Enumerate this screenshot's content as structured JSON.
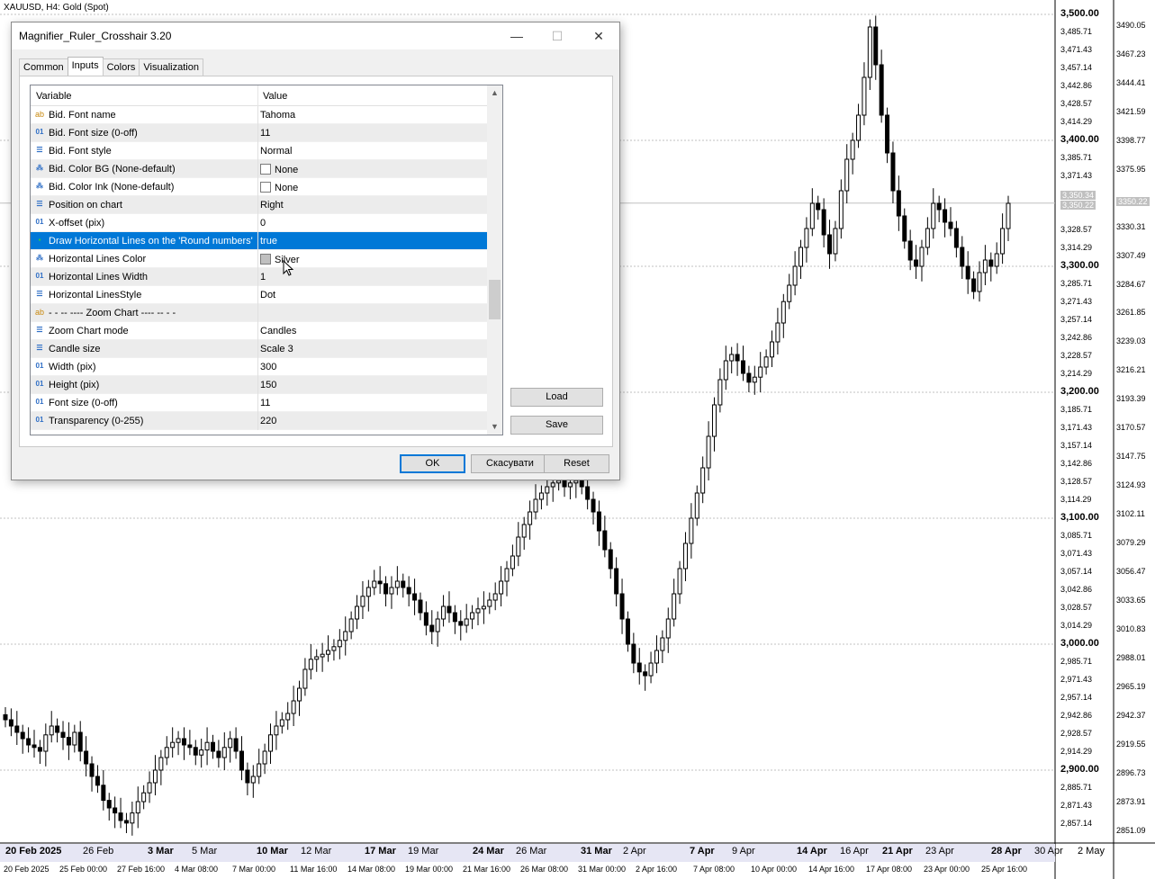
{
  "chart": {
    "symbol_label": "XAUUSD, H4:  Gold (Spot)",
    "grid_color": "#c0c0c0",
    "candle_color": "#000000",
    "price_scale": [
      {
        "text": "3,500.00",
        "price": 3500.0,
        "round": true
      },
      {
        "text": "3,485.71",
        "price": 3485.71
      },
      {
        "text": "3,471.43",
        "price": 3471.43
      },
      {
        "text": "3,457.14",
        "price": 3457.14
      },
      {
        "text": "3,442.86",
        "price": 3442.86
      },
      {
        "text": "3,428.57",
        "price": 3428.57
      },
      {
        "text": "3,414.29",
        "price": 3414.29
      },
      {
        "text": "3,400.00",
        "price": 3400.0,
        "round": true
      },
      {
        "text": "3,385.71",
        "price": 3385.71
      },
      {
        "text": "3,371.43",
        "price": 3371.43
      },
      {
        "text": "3,328.57",
        "price": 3328.57
      },
      {
        "text": "3,314.29",
        "price": 3314.29
      },
      {
        "text": "3,300.00",
        "price": 3300.0,
        "round": true
      },
      {
        "text": "3,285.71",
        "price": 3285.71
      },
      {
        "text": "3,271.43",
        "price": 3271.43
      },
      {
        "text": "3,257.14",
        "price": 3257.14
      },
      {
        "text": "3,242.86",
        "price": 3242.86
      },
      {
        "text": "3,228.57",
        "price": 3228.57
      },
      {
        "text": "3,214.29",
        "price": 3214.29
      },
      {
        "text": "3,200.00",
        "price": 3200.0,
        "round": true
      },
      {
        "text": "3,185.71",
        "price": 3185.71
      },
      {
        "text": "3,171.43",
        "price": 3171.43
      },
      {
        "text": "3,157.14",
        "price": 3157.14
      },
      {
        "text": "3,142.86",
        "price": 3142.86
      },
      {
        "text": "3,128.57",
        "price": 3128.57
      },
      {
        "text": "3,114.29",
        "price": 3114.29
      },
      {
        "text": "3,100.00",
        "price": 3100.0,
        "round": true
      },
      {
        "text": "3,085.71",
        "price": 3085.71
      },
      {
        "text": "3,071.43",
        "price": 3071.43
      },
      {
        "text": "3,057.14",
        "price": 3057.14
      },
      {
        "text": "3,042.86",
        "price": 3042.86
      },
      {
        "text": "3,028.57",
        "price": 3028.57
      },
      {
        "text": "3,014.29",
        "price": 3014.29
      },
      {
        "text": "3,000.00",
        "price": 3000.0,
        "round": true
      },
      {
        "text": "2,985.71",
        "price": 2985.71
      },
      {
        "text": "2,971.43",
        "price": 2971.43
      },
      {
        "text": "2,957.14",
        "price": 2957.14
      },
      {
        "text": "2,942.86",
        "price": 2942.86
      },
      {
        "text": "2,928.57",
        "price": 2928.57
      },
      {
        "text": "2,914.29",
        "price": 2914.29
      },
      {
        "text": "2,900.00",
        "price": 2900.0,
        "round": true
      },
      {
        "text": "2,885.71",
        "price": 2885.71
      },
      {
        "text": "2,871.43",
        "price": 2871.43
      },
      {
        "text": "2,857.14",
        "price": 2857.14
      }
    ],
    "sub_scale": [
      {
        "text": "3490.05",
        "price": 3490.05
      },
      {
        "text": "3467.23",
        "price": 3467.23
      },
      {
        "text": "3444.41",
        "price": 3444.41
      },
      {
        "text": "3421.59",
        "price": 3421.59
      },
      {
        "text": "3398.77",
        "price": 3398.77
      },
      {
        "text": "3375.95",
        "price": 3375.95
      },
      {
        "text": "3330.31",
        "price": 3330.31
      },
      {
        "text": "3307.49",
        "price": 3307.49
      },
      {
        "text": "3284.67",
        "price": 3284.67
      },
      {
        "text": "3261.85",
        "price": 3261.85
      },
      {
        "text": "3239.03",
        "price": 3239.03
      },
      {
        "text": "3216.21",
        "price": 3216.21
      },
      {
        "text": "3193.39",
        "price": 3193.39
      },
      {
        "text": "3170.57",
        "price": 3170.57
      },
      {
        "text": "3147.75",
        "price": 3147.75
      },
      {
        "text": "3124.93",
        "price": 3124.93
      },
      {
        "text": "3102.11",
        "price": 3102.11
      },
      {
        "text": "3079.29",
        "price": 3079.29
      },
      {
        "text": "3056.47",
        "price": 3056.47
      },
      {
        "text": "3033.65",
        "price": 3033.65
      },
      {
        "text": "3010.83",
        "price": 3010.83
      },
      {
        "text": "2988.01",
        "price": 2988.01
      },
      {
        "text": "2965.19",
        "price": 2965.19
      },
      {
        "text": "2942.37",
        "price": 2942.37
      },
      {
        "text": "2919.55",
        "price": 2919.55
      },
      {
        "text": "2896.73",
        "price": 2896.73
      },
      {
        "text": "2873.91",
        "price": 2873.91
      },
      {
        "text": "2851.09",
        "price": 2851.09
      }
    ],
    "price_tags": {
      "ask": "3,350.34",
      "bid": "3,350.22",
      "sub": "3350.22"
    },
    "date_axis_top": [
      {
        "text": "20 Feb 2025",
        "bold": true
      },
      {
        "text": "26 Feb"
      },
      {
        "text": "3 Mar",
        "bold": true
      },
      {
        "text": "5 Mar"
      },
      {
        "text": "10 Mar",
        "bold": true
      },
      {
        "text": "12 Mar"
      },
      {
        "text": "17 Mar",
        "bold": true
      },
      {
        "text": "19 Mar"
      },
      {
        "text": "24 Mar",
        "bold": true
      },
      {
        "text": "26 Mar"
      },
      {
        "text": "31 Mar",
        "bold": true
      },
      {
        "text": "2 Apr"
      },
      {
        "text": "7 Apr",
        "bold": true
      },
      {
        "text": "9 Apr"
      },
      {
        "text": "14 Apr",
        "bold": true
      },
      {
        "text": "16 Apr"
      },
      {
        "text": "21 Apr",
        "bold": true
      },
      {
        "text": "23 Apr"
      },
      {
        "text": "28 Apr",
        "bold": true
      },
      {
        "text": "30 Apr"
      },
      {
        "text": "2 May"
      }
    ],
    "date_axis_bottom": [
      "20 Feb 2025",
      "25 Feb 00:00",
      "27 Feb 16:00",
      "4 Mar 08:00",
      "7 Mar 00:00",
      "11 Mar 16:00",
      "14 Mar 08:00",
      "19 Mar 00:00",
      "21 Mar 16:00",
      "26 Mar 08:00",
      "31 Mar 00:00",
      "2 Apr 16:00",
      "7 Apr 08:00",
      "10 Apr 00:00",
      "14 Apr 16:00",
      "17 Apr 08:00",
      "23 Apr 00:00",
      "25 Apr 16:00"
    ],
    "closes": [
      2940,
      2935,
      2930,
      2925,
      2920,
      2918,
      2915,
      2928,
      2935,
      2930,
      2926,
      2920,
      2930,
      2915,
      2905,
      2895,
      2888,
      2876,
      2870,
      2866,
      2860,
      2858,
      2866,
      2875,
      2882,
      2890,
      2900,
      2910,
      2918,
      2922,
      2925,
      2920,
      2918,
      2912,
      2916,
      2922,
      2915,
      2910,
      2918,
      2925,
      2915,
      2900,
      2890,
      2895,
      2905,
      2915,
      2928,
      2935,
      2940,
      2945,
      2955,
      2965,
      2980,
      2988,
      2990,
      2992,
      2995,
      2998,
      3003,
      3010,
      3020,
      3030,
      3038,
      3045,
      3050,
      3048,
      3040,
      3045,
      3050,
      3045,
      3040,
      3035,
      3025,
      3015,
      3010,
      3020,
      3030,
      3025,
      3018,
      3015,
      3020,
      3025,
      3028,
      3030,
      3035,
      3040,
      3050,
      3060,
      3070,
      3085,
      3095,
      3105,
      3115,
      3120,
      3125,
      3128,
      3130,
      3125,
      3128,
      3130,
      3125,
      3115,
      3105,
      3090,
      3075,
      3060,
      3040,
      3020,
      3000,
      2985,
      2978,
      2975,
      2985,
      2995,
      3005,
      3020,
      3040,
      3060,
      3080,
      3100,
      3120,
      3140,
      3165,
      3190,
      3210,
      3225,
      3230,
      3225,
      3215,
      3208,
      3212,
      3220,
      3228,
      3240,
      3255,
      3272,
      3285,
      3300,
      3315,
      3330,
      3350,
      3345,
      3325,
      3310,
      3330,
      3360,
      3385,
      3400,
      3420,
      3450,
      3490,
      3460,
      3420,
      3390,
      3360,
      3340,
      3320,
      3305,
      3300,
      3315,
      3330,
      3350,
      3345,
      3335,
      3330,
      3315,
      3300,
      3290,
      3280,
      3295,
      3305,
      3300,
      3310,
      3330,
      3350
    ]
  },
  "dialog": {
    "title": "Magnifier_Ruler_Crosshair 3.20",
    "controls": {
      "minimize": "—",
      "maximize": "☐",
      "close": "✕"
    },
    "tabs": [
      "Common",
      "Inputs",
      "Colors",
      "Visualization"
    ],
    "active_tab": 1,
    "grid_header": {
      "variable": "Variable",
      "value": "Value"
    },
    "rows": [
      {
        "icon": "ab",
        "name": "Bid. Font name",
        "value": "Tahoma"
      },
      {
        "icon": "01",
        "name": "Bid. Font size (0-off)",
        "value": "11"
      },
      {
        "icon": "enum",
        "name": "Bid. Font style",
        "value": "Normal"
      },
      {
        "icon": "color",
        "name": "Bid. Color BG (None-default)",
        "value": "None",
        "swatch": "#ffffff"
      },
      {
        "icon": "color",
        "name": "Bid. Color Ink (None-default)",
        "value": "None",
        "swatch": "#ffffff"
      },
      {
        "icon": "enum",
        "name": "Position on chart",
        "value": "Right"
      },
      {
        "icon": "01",
        "name": "X-offset (pix)",
        "value": "0"
      },
      {
        "icon": "bool",
        "name": "Draw Horizontal Lines on the 'Round numbers'",
        "value": "true",
        "selected": true
      },
      {
        "icon": "color",
        "name": "Horizontal Lines Color",
        "value": "Silver",
        "swatch": "#c0c0c0"
      },
      {
        "icon": "01",
        "name": "Horizontal Lines Width",
        "value": "1"
      },
      {
        "icon": "enum",
        "name": "Horizontal LinesStyle",
        "value": "Dot"
      },
      {
        "icon": "ab",
        "name": "-    -    -- ---- Zoom Chart ---- --    -    -",
        "value": ""
      },
      {
        "icon": "enum",
        "name": "Zoom Chart mode",
        "value": "Candles"
      },
      {
        "icon": "enum",
        "name": "Candle size",
        "value": "Scale 3"
      },
      {
        "icon": "01",
        "name": "Width (pix)",
        "value": "300"
      },
      {
        "icon": "01",
        "name": "Height (pix)",
        "value": "150"
      },
      {
        "icon": "01",
        "name": "Font size (0-off)",
        "value": "11"
      },
      {
        "icon": "01",
        "name": "Transparency (0-255)",
        "value": "220"
      }
    ],
    "buttons": {
      "load": "Load",
      "save": "Save",
      "ok": "OK",
      "cancel": "Скасувати",
      "reset": "Reset"
    },
    "accent_color": "#0078d7"
  }
}
